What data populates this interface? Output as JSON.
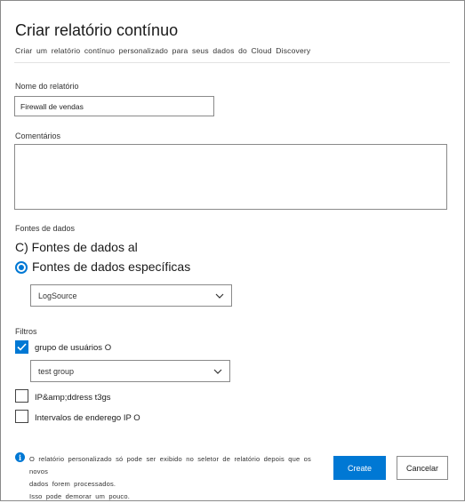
{
  "dialog": {
    "title": "Criar relatório contínuo",
    "subtitle": "Criar um relatório contínuo personalizado para seus dados do Cloud Discovery"
  },
  "report_name": {
    "label": "Nome do relatório",
    "value": "Firewall de vendas"
  },
  "comments": {
    "label": "Comentários",
    "value": ""
  },
  "data_sources": {
    "label": "Fontes de dados",
    "option_all": "C) Fontes de dados al",
    "option_specific": "Fontes de dados específicas",
    "selected": "specific",
    "source_select": "LogSource"
  },
  "filters": {
    "label": "Filtros",
    "user_group": {
      "label": "grupo de usuários O",
      "checked": true,
      "select": "test group"
    },
    "ip_tags": {
      "label": "IP&amp;ddress t3gs",
      "checked": false
    },
    "ip_ranges": {
      "label": "Intervalos de enderego IP O",
      "checked": false
    }
  },
  "note": {
    "line1": "O relatório personalizado só pode ser exibido no seletor de relatório depois que os novos",
    "line2": "dados forem processados.",
    "line3": "Isso pode demorar um pouco."
  },
  "buttons": {
    "create": "Create",
    "cancel": "Cancelar"
  },
  "colors": {
    "accent": "#0078d4",
    "border": "#8a8a8a"
  },
  "icons": [
    "chevron-down-icon",
    "checkmark-icon",
    "info-icon",
    "radio-selected-icon"
  ]
}
